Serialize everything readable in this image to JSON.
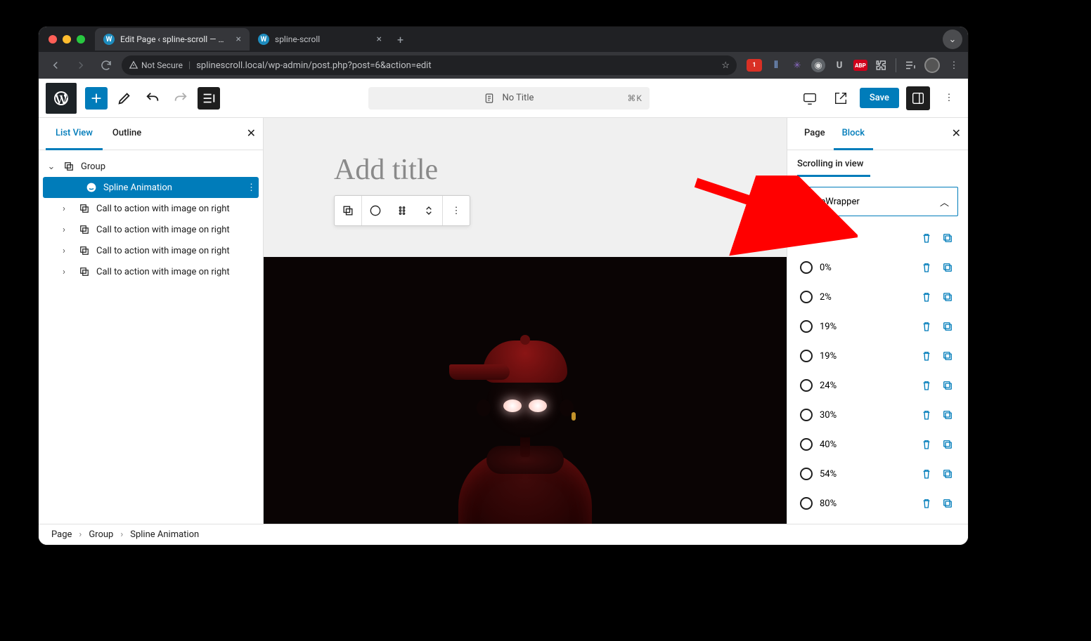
{
  "browser": {
    "tabs": [
      {
        "title": "Edit Page ‹ spline-scroll — Wo",
        "active": true
      },
      {
        "title": "spline-scroll",
        "active": false
      }
    ],
    "secure_label": "Not Secure",
    "url": "splinescroll.local/wp-admin/post.php?post=6&action=edit",
    "ext_badge": "1",
    "abp_label": "ABP"
  },
  "wp_top": {
    "cmd_label": "No Title",
    "cmd_kbd": "⌘K",
    "save_label": "Save"
  },
  "listview": {
    "tab_list": "List View",
    "tab_outline": "Outline",
    "rows": {
      "group": "Group",
      "spline": "Spline Animation",
      "cta": "Call to action with image on right"
    }
  },
  "canvas": {
    "title_placeholder": "Add title"
  },
  "right_panel": {
    "tab_page": "Page",
    "tab_block": "Block",
    "section_label": "Scrolling in view",
    "selector_value": ".bikeWrapper",
    "keyframes": [
      {
        "pct": "0%",
        "checked": true
      },
      {
        "pct": "0%",
        "checked": false
      },
      {
        "pct": "2%",
        "checked": false
      },
      {
        "pct": "19%",
        "checked": false
      },
      {
        "pct": "19%",
        "checked": false
      },
      {
        "pct": "24%",
        "checked": false
      },
      {
        "pct": "30%",
        "checked": false
      },
      {
        "pct": "40%",
        "checked": false
      },
      {
        "pct": "54%",
        "checked": false
      },
      {
        "pct": "80%",
        "checked": false
      }
    ]
  },
  "breadcrumb": [
    "Page",
    "Group",
    "Spline Animation"
  ]
}
